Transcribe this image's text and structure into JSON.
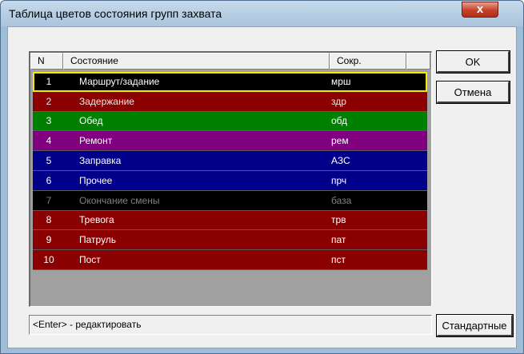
{
  "window": {
    "title": "Таблица цветов состояния групп захвата",
    "close_label": "x"
  },
  "table": {
    "columns": {
      "n": "N",
      "state": "Состояние",
      "abbr": "Сокр."
    },
    "rows": [
      {
        "n": "1",
        "state": "Маршрут/задание",
        "abbr": "мрш",
        "bg": "#000000",
        "fg": "#ffffff",
        "selected": true
      },
      {
        "n": "2",
        "state": "Задержание",
        "abbr": "здр",
        "bg": "#8b0000",
        "fg": "#e8e8e8"
      },
      {
        "n": "3",
        "state": "Обед",
        "abbr": "обд",
        "bg": "#008000",
        "fg": "#ffffff"
      },
      {
        "n": "4",
        "state": "Ремонт",
        "abbr": "рем",
        "bg": "#800080",
        "fg": "#ffffff"
      },
      {
        "n": "5",
        "state": "Заправка",
        "abbr": "АЗС",
        "bg": "#00008b",
        "fg": "#ffffff"
      },
      {
        "n": "6",
        "state": "Прочее",
        "abbr": "прч",
        "bg": "#00008b",
        "fg": "#ffffff"
      },
      {
        "n": "7",
        "state": "Окончание смены",
        "abbr": "база",
        "bg": "#000000",
        "fg": "#808080"
      },
      {
        "n": "8",
        "state": "Тревога",
        "abbr": "трв",
        "bg": "#8b0000",
        "fg": "#ffffff"
      },
      {
        "n": "9",
        "state": "Патруль",
        "abbr": "пат",
        "bg": "#8b0000",
        "fg": "#ffffff"
      },
      {
        "n": "10",
        "state": "Пост",
        "abbr": "пст",
        "bg": "#8b0000",
        "fg": "#ffffff"
      }
    ]
  },
  "buttons": {
    "ok": "OK",
    "cancel": "Отмена",
    "defaults": "Стандартные"
  },
  "status_text": "<Enter> - редактировать",
  "colors": {
    "selection_outline": "#ffe600",
    "table_background": "#a0a0a0"
  }
}
